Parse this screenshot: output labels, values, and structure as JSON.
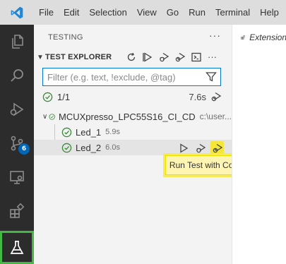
{
  "menubar": {
    "items": [
      "File",
      "Edit",
      "Selection",
      "View",
      "Go",
      "Run",
      "Terminal",
      "Help"
    ]
  },
  "activitybar": {
    "items": [
      {
        "name": "explorer",
        "icon": "files-icon"
      },
      {
        "name": "search",
        "icon": "search-icon"
      },
      {
        "name": "run-debug",
        "icon": "debug-icon"
      },
      {
        "name": "source-control",
        "icon": "source-control-icon",
        "badge": "6"
      },
      {
        "name": "remote-explorer",
        "icon": "remote-explorer-icon"
      },
      {
        "name": "extensions",
        "icon": "extensions-icon"
      },
      {
        "name": "testing",
        "icon": "beaker-icon",
        "active": true
      }
    ]
  },
  "sidebar": {
    "title": "TESTING",
    "more": "···",
    "section": {
      "title": "TEST EXPLORER",
      "more": "···"
    },
    "filter": {
      "placeholder": "Filter (e.g. text, !exclude, @tag)",
      "value": ""
    },
    "summary": {
      "count": "1/1",
      "duration": "7.6s"
    },
    "tree": [
      {
        "label": "MCUXpresso_LPC55S16_CI_CD",
        "sub": "c:\\user...",
        "expanded": true,
        "status": "passed"
      },
      {
        "label": "Led_1",
        "sub": "5.9s",
        "status": "passed"
      },
      {
        "label": "Led_2",
        "sub": "6.0s",
        "status": "passed",
        "selected": true
      }
    ]
  },
  "tooltip": {
    "text": "Run Test with Coverage"
  },
  "editor": {
    "tab_label": "Extension"
  },
  "colors": {
    "activitybar_bg": "#2c2c2c",
    "active_highlight": "#43b843",
    "pass_green": "#388a34",
    "filter_border": "#0078d4",
    "badge_blue": "#0066b8",
    "tooltip_bg": "#fff5b2",
    "coverage_highlight": "#f5e63a"
  }
}
